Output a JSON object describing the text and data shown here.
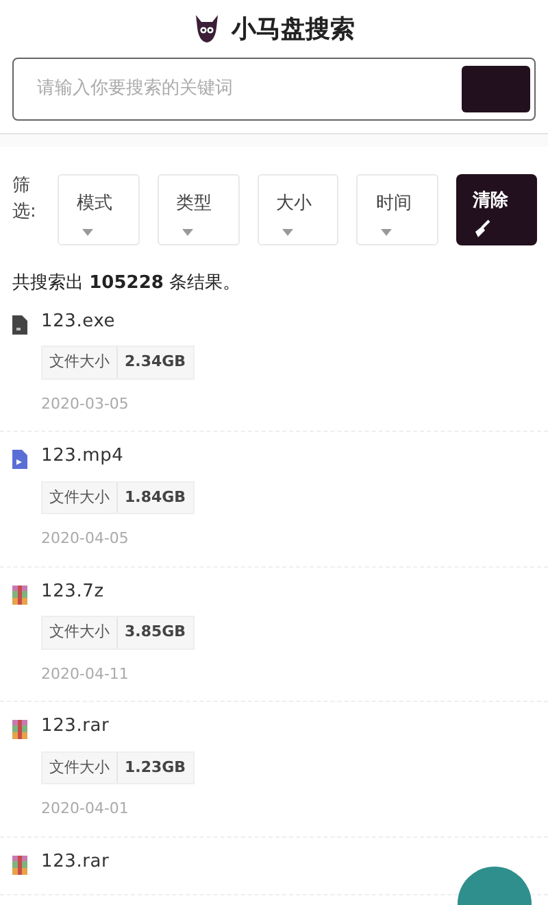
{
  "header": {
    "title": "小马盘搜索"
  },
  "search": {
    "placeholder": "请输入你要搜索的关键词"
  },
  "filters": {
    "label": "筛选:",
    "dropdowns": [
      "模式",
      "类型",
      "大小",
      "时间"
    ],
    "clear_button": "清除"
  },
  "result_count": "共搜索出 **105228** 条结果。",
  "files": [
    {
      "kind": "exe",
      "name": "123.exe",
      "size_label": "文件大小",
      "size": "2.34GB",
      "date": "2020-03-05"
    },
    {
      "kind": "video",
      "name": "123.mp4",
      "size_label": "文件大小",
      "size": "1.84GB",
      "date": "2020-04-05"
    },
    {
      "kind": "archive",
      "name": "123.7z",
      "size_label": "文件大小",
      "size": "3.85GB",
      "date": "2020-04-11"
    },
    {
      "kind": "archive",
      "name": "123.rar",
      "size_label": "文件大小",
      "size": "1.23GB",
      "date": "2020-04-01"
    },
    {
      "kind": "archive",
      "name": "123.rar"
    }
  ]
}
